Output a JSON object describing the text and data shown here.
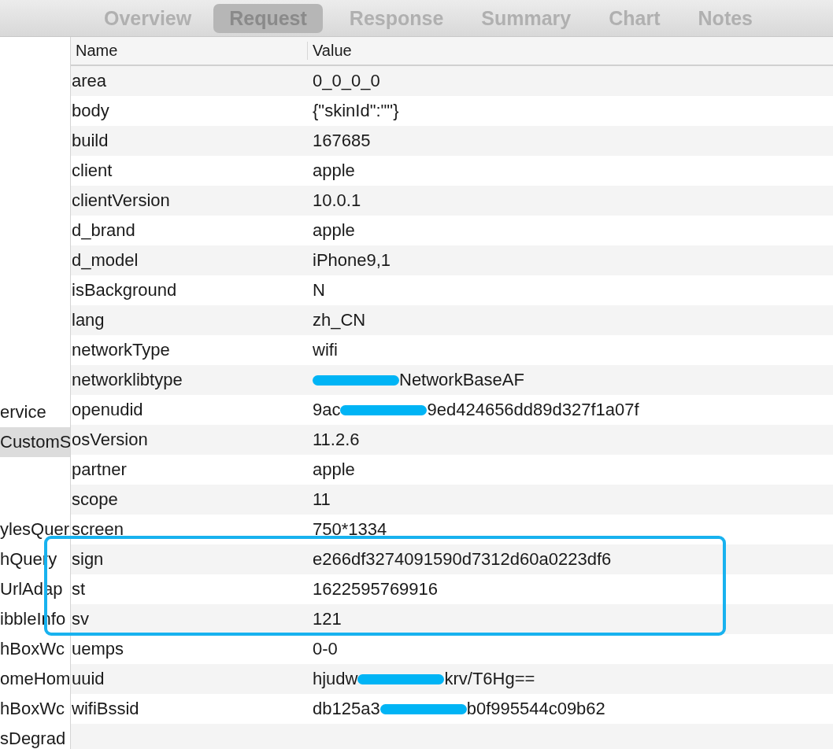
{
  "tabs": [
    {
      "label": "Overview",
      "selected": false
    },
    {
      "label": "Request",
      "selected": true
    },
    {
      "label": "Response",
      "selected": false
    },
    {
      "label": "Summary",
      "selected": false
    },
    {
      "label": "Chart",
      "selected": false
    },
    {
      "label": "Notes",
      "selected": false
    }
  ],
  "sidebar": {
    "upper_items": [
      {
        "label": "ervice",
        "selected": false
      },
      {
        "label": "CustomS",
        "selected": true
      }
    ],
    "lower_items": [
      {
        "label": "ylesQuer",
        "selected": false
      },
      {
        "label": "hQuery",
        "selected": false
      },
      {
        "label": "UrlAdap",
        "selected": false
      },
      {
        "label": "ibbleInfo",
        "selected": false
      },
      {
        "label": "hBoxWc",
        "selected": false
      },
      {
        "label": "omeHom",
        "selected": false
      },
      {
        "label": "hBoxWc",
        "selected": false
      },
      {
        "label": "sDegrad",
        "selected": false
      }
    ]
  },
  "table": {
    "columns": [
      "Name",
      "Value"
    ],
    "row_groups": [
      {
        "highlighted": false,
        "rows": [
          {
            "name": "area",
            "value": [
              {
                "kind": "text",
                "text": "0_0_0_0"
              }
            ]
          },
          {
            "name": "body",
            "value": [
              {
                "kind": "text",
                "text": "{\"skinId\":\"\"}"
              }
            ]
          },
          {
            "name": "build",
            "value": [
              {
                "kind": "text",
                "text": "167685"
              }
            ]
          },
          {
            "name": "client",
            "value": [
              {
                "kind": "text",
                "text": "apple"
              }
            ]
          },
          {
            "name": "clientVersion",
            "value": [
              {
                "kind": "text",
                "text": "10.0.1"
              }
            ]
          },
          {
            "name": "d_brand",
            "value": [
              {
                "kind": "text",
                "text": "apple"
              }
            ]
          },
          {
            "name": "d_model",
            "value": [
              {
                "kind": "text",
                "text": "iPhone9,1"
              }
            ]
          },
          {
            "name": "isBackground",
            "value": [
              {
                "kind": "text",
                "text": "N"
              }
            ]
          },
          {
            "name": "lang",
            "value": [
              {
                "kind": "text",
                "text": "zh_CN"
              }
            ]
          },
          {
            "name": "networkType",
            "value": [
              {
                "kind": "text",
                "text": "wifi"
              }
            ]
          },
          {
            "name": "networklibtype",
            "value": [
              {
                "kind": "redaction"
              },
              {
                "kind": "text",
                "text": "NetworkBaseAF"
              }
            ]
          },
          {
            "name": "openudid",
            "value": [
              {
                "kind": "text",
                "text": "9ac"
              },
              {
                "kind": "redaction"
              },
              {
                "kind": "text",
                "text": "9ed424656dd89d327f1a07f"
              }
            ]
          },
          {
            "name": "osVersion",
            "value": [
              {
                "kind": "text",
                "text": "11.2.6"
              }
            ]
          },
          {
            "name": "partner",
            "value": [
              {
                "kind": "text",
                "text": "apple"
              }
            ]
          },
          {
            "name": "scope",
            "value": [
              {
                "kind": "text",
                "text": "11"
              }
            ]
          },
          {
            "name": "screen",
            "value": [
              {
                "kind": "text",
                "text": "750*1334"
              }
            ]
          }
        ]
      },
      {
        "highlighted": true,
        "rows": [
          {
            "name": "sign",
            "value": [
              {
                "kind": "text",
                "text": "e266df3274091590d7312d60a0223df6"
              }
            ]
          },
          {
            "name": "st",
            "value": [
              {
                "kind": "text",
                "text": "1622595769916"
              }
            ]
          },
          {
            "name": "sv",
            "value": [
              {
                "kind": "text",
                "text": "121"
              }
            ]
          }
        ]
      },
      {
        "highlighted": false,
        "rows": [
          {
            "name": "uemps",
            "value": [
              {
                "kind": "text",
                "text": "0-0"
              }
            ]
          },
          {
            "name": "uuid",
            "value": [
              {
                "kind": "text",
                "text": "hjudw"
              },
              {
                "kind": "redaction"
              },
              {
                "kind": "text",
                "text": "krv/T6Hg=="
              }
            ]
          },
          {
            "name": "wifiBssid",
            "value": [
              {
                "kind": "text",
                "text": "db125a3"
              },
              {
                "kind": "redaction"
              },
              {
                "kind": "text",
                "text": "b0f995544c09b62"
              }
            ]
          }
        ]
      }
    ]
  }
}
